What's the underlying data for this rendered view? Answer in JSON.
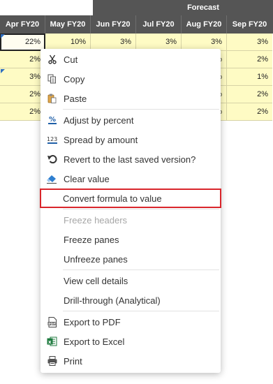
{
  "grid": {
    "band_label": "Forecast",
    "columns": [
      "Apr FY20",
      "May FY20",
      "Jun FY20",
      "Jul FY20",
      "Aug FY20",
      "Sep FY20"
    ],
    "rows": [
      [
        "22%",
        "10%",
        "3%",
        "3%",
        "3%",
        "3%"
      ],
      [
        "2%",
        "",
        "",
        "",
        "%",
        "2%"
      ],
      [
        "3%",
        "",
        "",
        "",
        "%",
        "1%"
      ],
      [
        "2%",
        "",
        "",
        "",
        "%",
        "2%"
      ],
      [
        "2%",
        "",
        "",
        "",
        "%",
        "2%"
      ]
    ]
  },
  "menu": {
    "cut": "Cut",
    "copy": "Copy",
    "paste": "Paste",
    "adjust_by_percent": "Adjust by percent",
    "spread_by_amount": "Spread by amount",
    "revert": "Revert to the last saved version?",
    "clear_value": "Clear value",
    "convert_formula": "Convert formula to value",
    "freeze_headers": "Freeze headers",
    "freeze_panes": "Freeze panes",
    "unfreeze_panes": "Unfreeze panes",
    "view_cell_details": "View cell details",
    "drill_through": "Drill-through (Analytical)",
    "export_pdf": "Export to PDF",
    "export_excel": "Export to Excel",
    "print": "Print"
  },
  "icons": {
    "cut": "scissors-icon",
    "copy": "copy-icon",
    "paste": "paste-icon",
    "adjust": "percent-icon",
    "spread": "number-123-icon",
    "revert": "undo-icon",
    "clear": "eraser-icon",
    "pdf": "pdf-icon",
    "excel": "excel-icon",
    "print": "printer-icon"
  },
  "colors": {
    "header_bg": "#555555",
    "cell_bg": "#fefbc4",
    "highlight_border": "#d9252b",
    "flag": "#2f6fc0"
  }
}
